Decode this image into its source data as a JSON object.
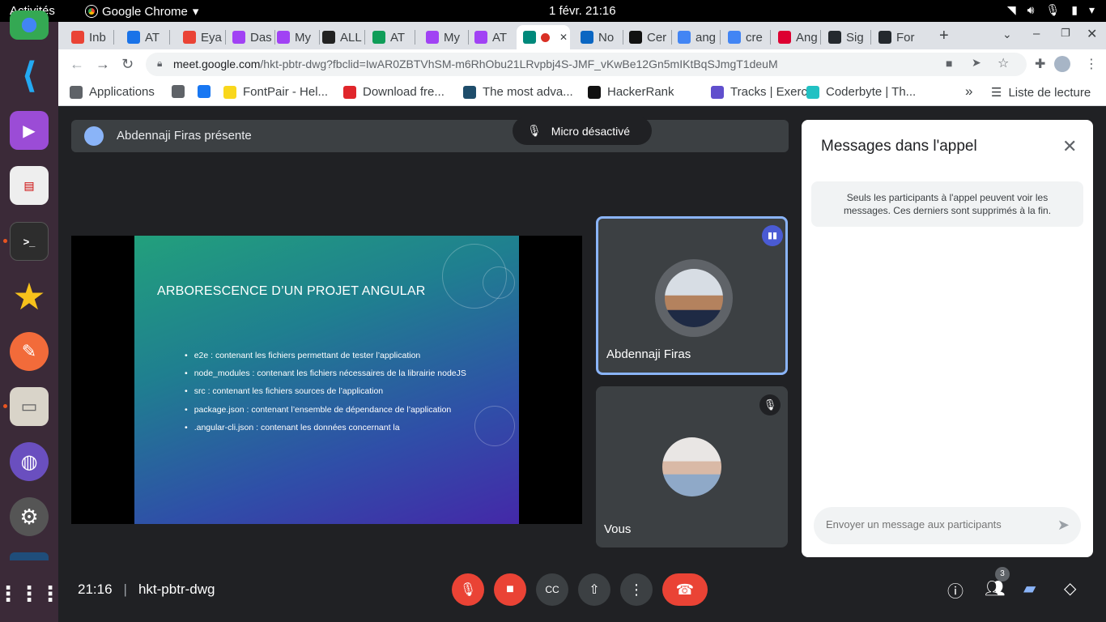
{
  "system": {
    "activities": "Activités",
    "app_name": "Google Chrome",
    "clock": "1 févr.  21:16"
  },
  "tabs": [
    {
      "label": "Inb",
      "icon": "gmail-icon",
      "color": "#ea4335"
    },
    {
      "label": "AT",
      "icon": "calendar-icon",
      "color": "#1a73e8"
    },
    {
      "label": "Eya",
      "icon": "gmail-icon",
      "color": "#ea4335"
    },
    {
      "label": "Das",
      "icon": "spiral-icon",
      "color": "#a142f4"
    },
    {
      "label": "My",
      "icon": "spiral-icon",
      "color": "#a142f4"
    },
    {
      "label": "ALL",
      "icon": "arrow-logo-icon",
      "color": "#222"
    },
    {
      "label": "AT",
      "icon": "sheets-icon",
      "color": "#0f9d58"
    },
    {
      "label": "My",
      "icon": "spiral-icon",
      "color": "#a142f4"
    },
    {
      "label": "AT",
      "icon": "spiral-icon",
      "color": "#a142f4"
    },
    {
      "label": "",
      "icon": "meet-icon",
      "color": "#00897b"
    },
    {
      "label": "No",
      "icon": "linkedin-icon",
      "color": "#0a66c2"
    },
    {
      "label": "Cer",
      "icon": "bracket-icon",
      "color": "#111"
    },
    {
      "label": "ang",
      "icon": "google-icon",
      "color": "#4285f4"
    },
    {
      "label": "cre",
      "icon": "google-icon",
      "color": "#4285f4"
    },
    {
      "label": "Ang",
      "icon": "angular-icon",
      "color": "#dd0031"
    },
    {
      "label": "Sig",
      "icon": "github-icon",
      "color": "#24292e"
    },
    {
      "label": "For",
      "icon": "github-icon",
      "color": "#24292e"
    }
  ],
  "omnibox": {
    "domain": "meet.google.com",
    "path": "/hkt-pbtr-dwg?fbclid=IwAR0ZBTVhSM-m6RhObu21LRvpbj4S-JMF_vKwBe12Gn5mIKtBqSJmgT1deuM"
  },
  "bookmarks": [
    {
      "label": "Applications",
      "icon": "apps-grid-icon",
      "color": "#5f6368"
    },
    {
      "label": "",
      "icon": "globe-icon",
      "color": "#5f6368"
    },
    {
      "label": "",
      "icon": "facebook-icon",
      "color": "#1877f2"
    },
    {
      "label": "FontPair - Hel...",
      "icon": "fontpair-icon",
      "color": "#f9d71c"
    },
    {
      "label": "Download fre...",
      "icon": "hexagon-icon",
      "color": "#e0262b"
    },
    {
      "label": "The most adva...",
      "icon": "f-logo-icon",
      "color": "#1e4d6b"
    },
    {
      "label": "HackerRank",
      "icon": "hackerrank-icon",
      "color": "#111"
    },
    {
      "label": "Tracks | Exerci...",
      "icon": "exercism-icon",
      "color": "#604fcd"
    },
    {
      "label": "Coderbyte | Th...",
      "icon": "coderbyte-icon",
      "color": "#22c1c3"
    }
  ],
  "bookmarks_more": "»",
  "reading_list": "Liste de lecture",
  "meet": {
    "presenting": "Abdennaji Firas présente",
    "mic_toast": "Micro désactivé",
    "slide": {
      "title": "ARBORESCENCE D’UN PROJET ANGULAR",
      "bullets": [
        "e2e : contenant les fichiers permettant de tester l’application",
        "node_modules : contenant les fichiers nécessaires de la librairie nodeJS",
        "src : contenant les fichiers sources de l’application",
        "package.json : contenant l’ensemble de dépendance de l’application",
        ".angular-cli.json : contenant les données concernant la"
      ]
    },
    "participants": [
      {
        "name": "Abdennaji Firas",
        "speaking": true
      },
      {
        "name": "Vous",
        "muted": true
      }
    ],
    "chat": {
      "title": "Messages dans l'appel",
      "note": "Seuls les participants à l'appel peuvent voir les messages. Ces derniers sont supprimés à la fin.",
      "placeholder": "Envoyer un message aux participants"
    },
    "time": "21:16",
    "meeting_code": "hkt-pbtr-dwg",
    "participant_count": "3"
  }
}
